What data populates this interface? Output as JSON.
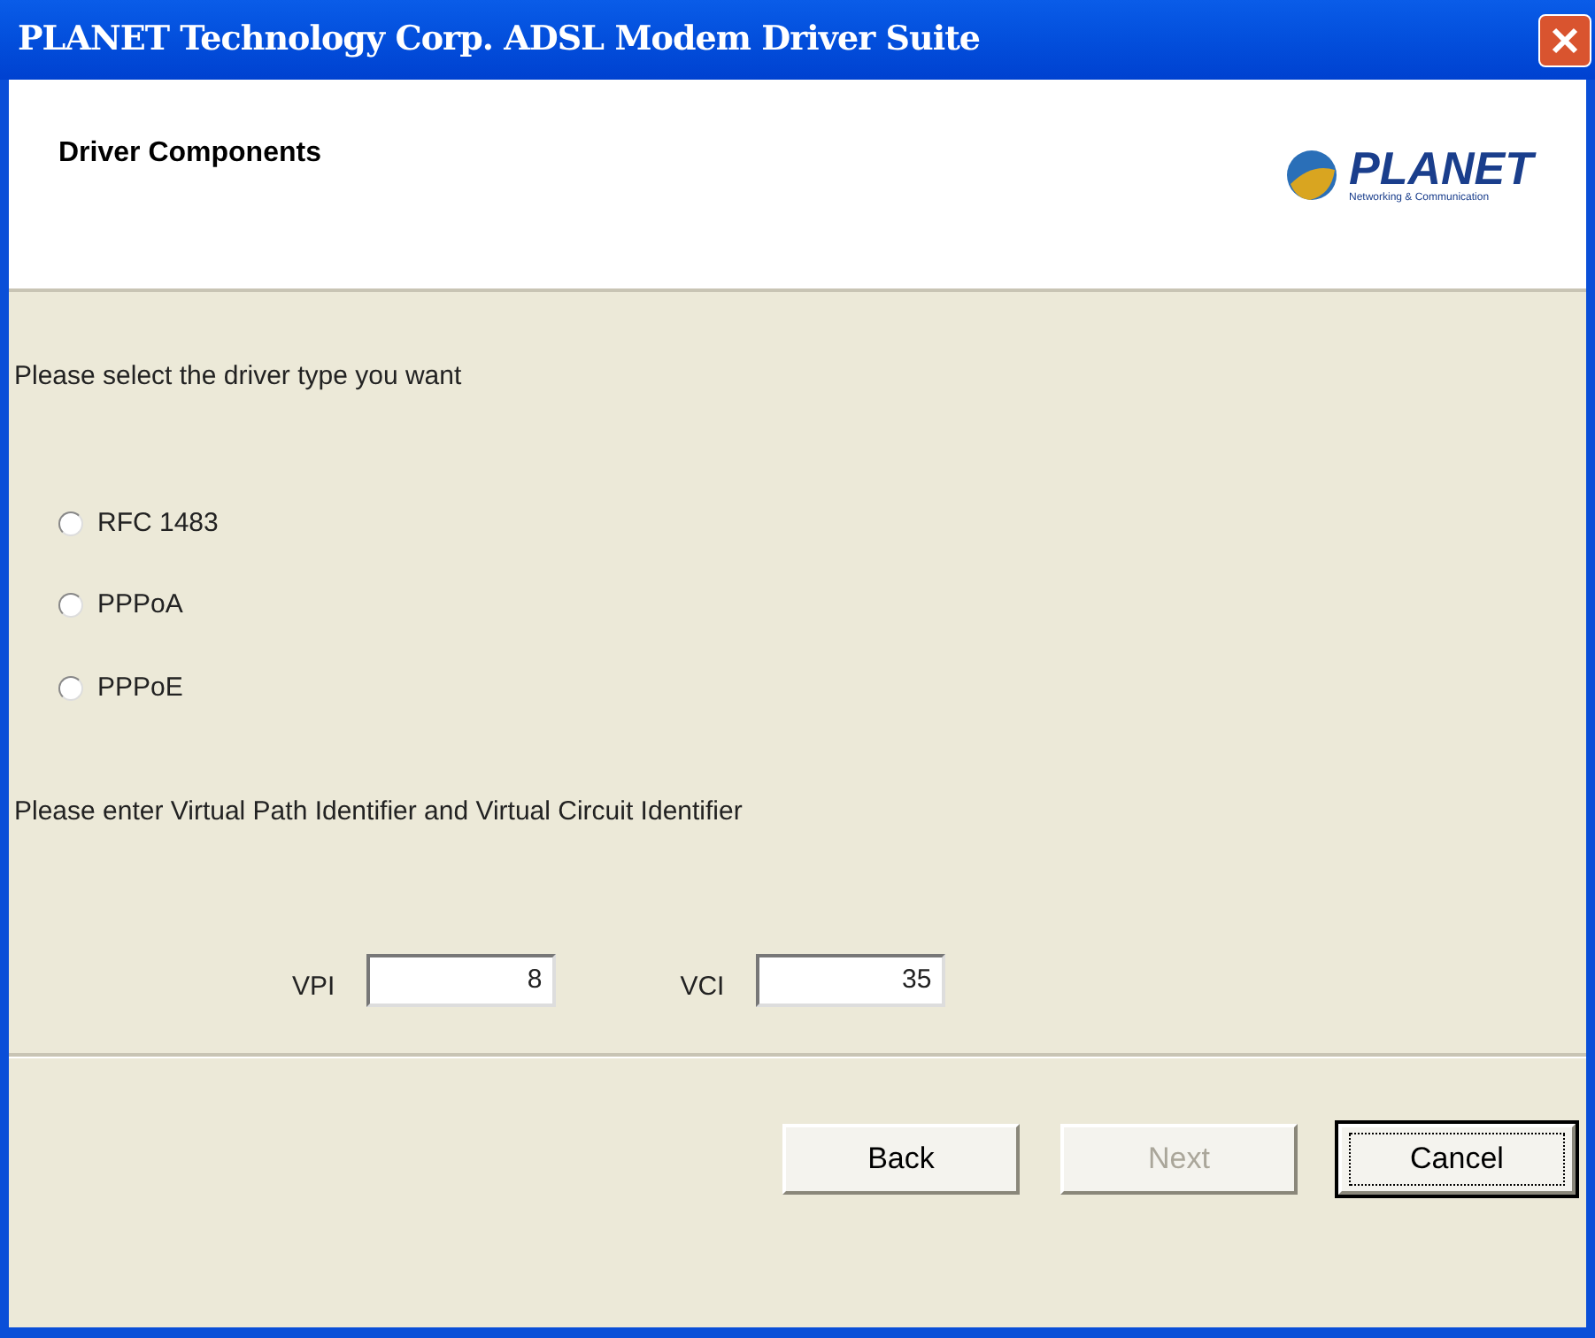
{
  "window": {
    "title": "PLANET Technology Corp. ADSL Modem Driver Suite"
  },
  "header": {
    "title": "Driver Components",
    "logo": {
      "name": "PLANET",
      "tagline": "Networking & Communication"
    }
  },
  "prompt": "Please select the driver type you want",
  "driver_types": [
    {
      "label": "RFC 1483",
      "selected": false
    },
    {
      "label": "PPPoA",
      "selected": false
    },
    {
      "label": "PPPoE",
      "selected": false
    }
  ],
  "identifier_prompt": "Please enter Virtual Path Identifier and Virtual Circuit Identifier",
  "fields": [
    {
      "label": "VPI",
      "value": "8"
    },
    {
      "label": "VCI",
      "value": "35"
    }
  ],
  "buttons": [
    {
      "label": "Back",
      "disabled": false,
      "default": false
    },
    {
      "label": "Next",
      "disabled": true,
      "default": false
    },
    {
      "label": "Cancel",
      "disabled": false,
      "default": true
    }
  ]
}
